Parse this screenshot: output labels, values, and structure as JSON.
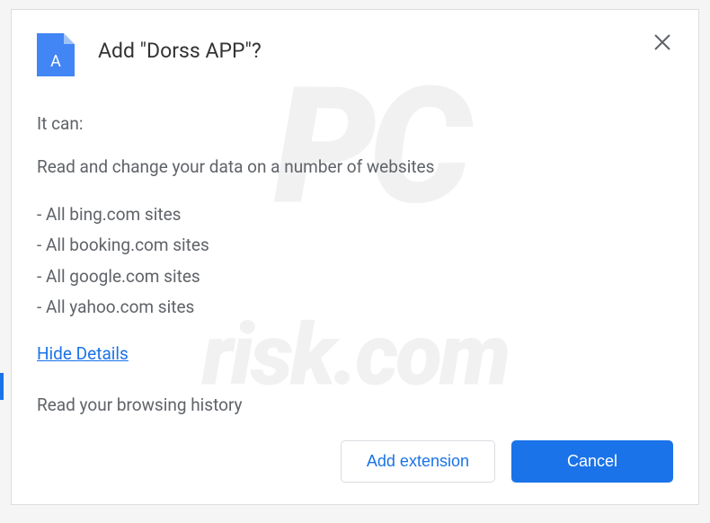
{
  "dialog": {
    "title": "Add \"Dorss APP\"?",
    "itCan": "It can:",
    "description": "Read and change your data on a number of websites",
    "sites": [
      "- All bing.com sites",
      "- All booking.com sites",
      "- All google.com sites",
      "- All yahoo.com sites"
    ],
    "hideDetails": "Hide Details",
    "historyText": "Read your browsing history",
    "addButton": "Add extension",
    "cancelButton": "Cancel",
    "appIconLetter": "A"
  },
  "watermark": {
    "top": "PC",
    "bottom": "risk.com"
  }
}
